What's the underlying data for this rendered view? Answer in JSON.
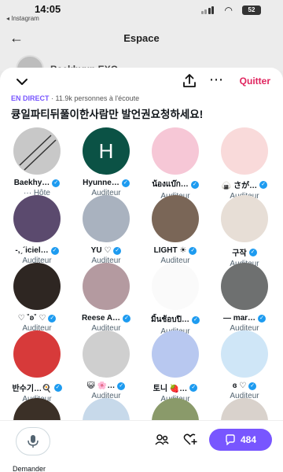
{
  "status_bar": {
    "time": "14:05",
    "back_app": "◂ Instagram",
    "battery": "52"
  },
  "background": {
    "title": "Espace",
    "host_name": "Baekhyun EXO"
  },
  "sheet": {
    "quit_label": "Quitter",
    "live_label": "EN DIRECT",
    "listeners": " · 11.9k personnes à l'écoute",
    "title": "큥일파티뒤풀이한사람만 발언권요청하세요!"
  },
  "participants": [
    {
      "name": "Baekhy…",
      "role": "··· Hôte",
      "verified": true,
      "bg": "#c8c8c8"
    },
    {
      "name": "Hyunne…",
      "role": "Auditeur",
      "verified": true,
      "bg": "#0b5245",
      "letter": "H"
    },
    {
      "name": "น้องแบ๊ก…",
      "role": "Auditeur",
      "verified": true,
      "bg": "#f6c7d6"
    },
    {
      "name": "🍙 さが…",
      "role": "Auditeur",
      "verified": true,
      "bg": "#f9dada"
    },
    {
      "name": "-,ˏ´iciel…",
      "role": "Auditeur",
      "verified": true,
      "bg": "#5b4a6e"
    },
    {
      "name": "YU ♡",
      "role": "Auditeur",
      "verified": true,
      "bg": "#a9b2bf"
    },
    {
      "name": "LIGHT ☀",
      "role": "Auditeur",
      "verified": true,
      "bg": "#7a6657"
    },
    {
      "name": "구작",
      "role": "Auditeur",
      "verified": true,
      "bg": "#e7ded6"
    },
    {
      "name": "♡ ˚ʚ˚ ♡",
      "role": "Auditeur",
      "verified": true,
      "bg": "#2e2622"
    },
    {
      "name": "Reese A…",
      "role": "Auditeur",
      "verified": true,
      "bg": "#b49aa0"
    },
    {
      "name": "มิ้นช้อบปิ…",
      "role": "Auditeur",
      "verified": true,
      "bg": "#fafafa"
    },
    {
      "name": "— mar…",
      "role": "Auditeur",
      "verified": true,
      "bg": "#6e7070"
    },
    {
      "name": "반수기…🍳",
      "role": "Auditeur",
      "verified": true,
      "bg": "#d73a3a"
    },
    {
      "name": "😺 🌸…",
      "role": "Auditeur",
      "verified": true,
      "bg": "#cfcfcf"
    },
    {
      "name": "토니 🍓…",
      "role": "Auditeur",
      "verified": true,
      "bg": "#b8c8f0"
    },
    {
      "name": "ɞ ♡",
      "role": "Auditeur",
      "verified": true,
      "bg": "#cfe6f7"
    },
    {
      "name": "",
      "role": "",
      "verified": false,
      "bg": "#3b3027"
    },
    {
      "name": "",
      "role": "",
      "verified": false,
      "bg": "#c7d9ea"
    },
    {
      "name": "",
      "role": "",
      "verified": false,
      "bg": "#8a9a6a"
    },
    {
      "name": "",
      "role": "",
      "verified": false,
      "bg": "#d9d2cc"
    }
  ],
  "bottom": {
    "mic_label": "Demander",
    "reply_count": "484"
  },
  "icons": {
    "chevron": "chevron-down-icon",
    "share": "share-icon",
    "more": "more-icon",
    "mic": "microphone-icon",
    "people": "people-icon",
    "heart": "heart-add-icon",
    "comment": "comment-icon"
  }
}
